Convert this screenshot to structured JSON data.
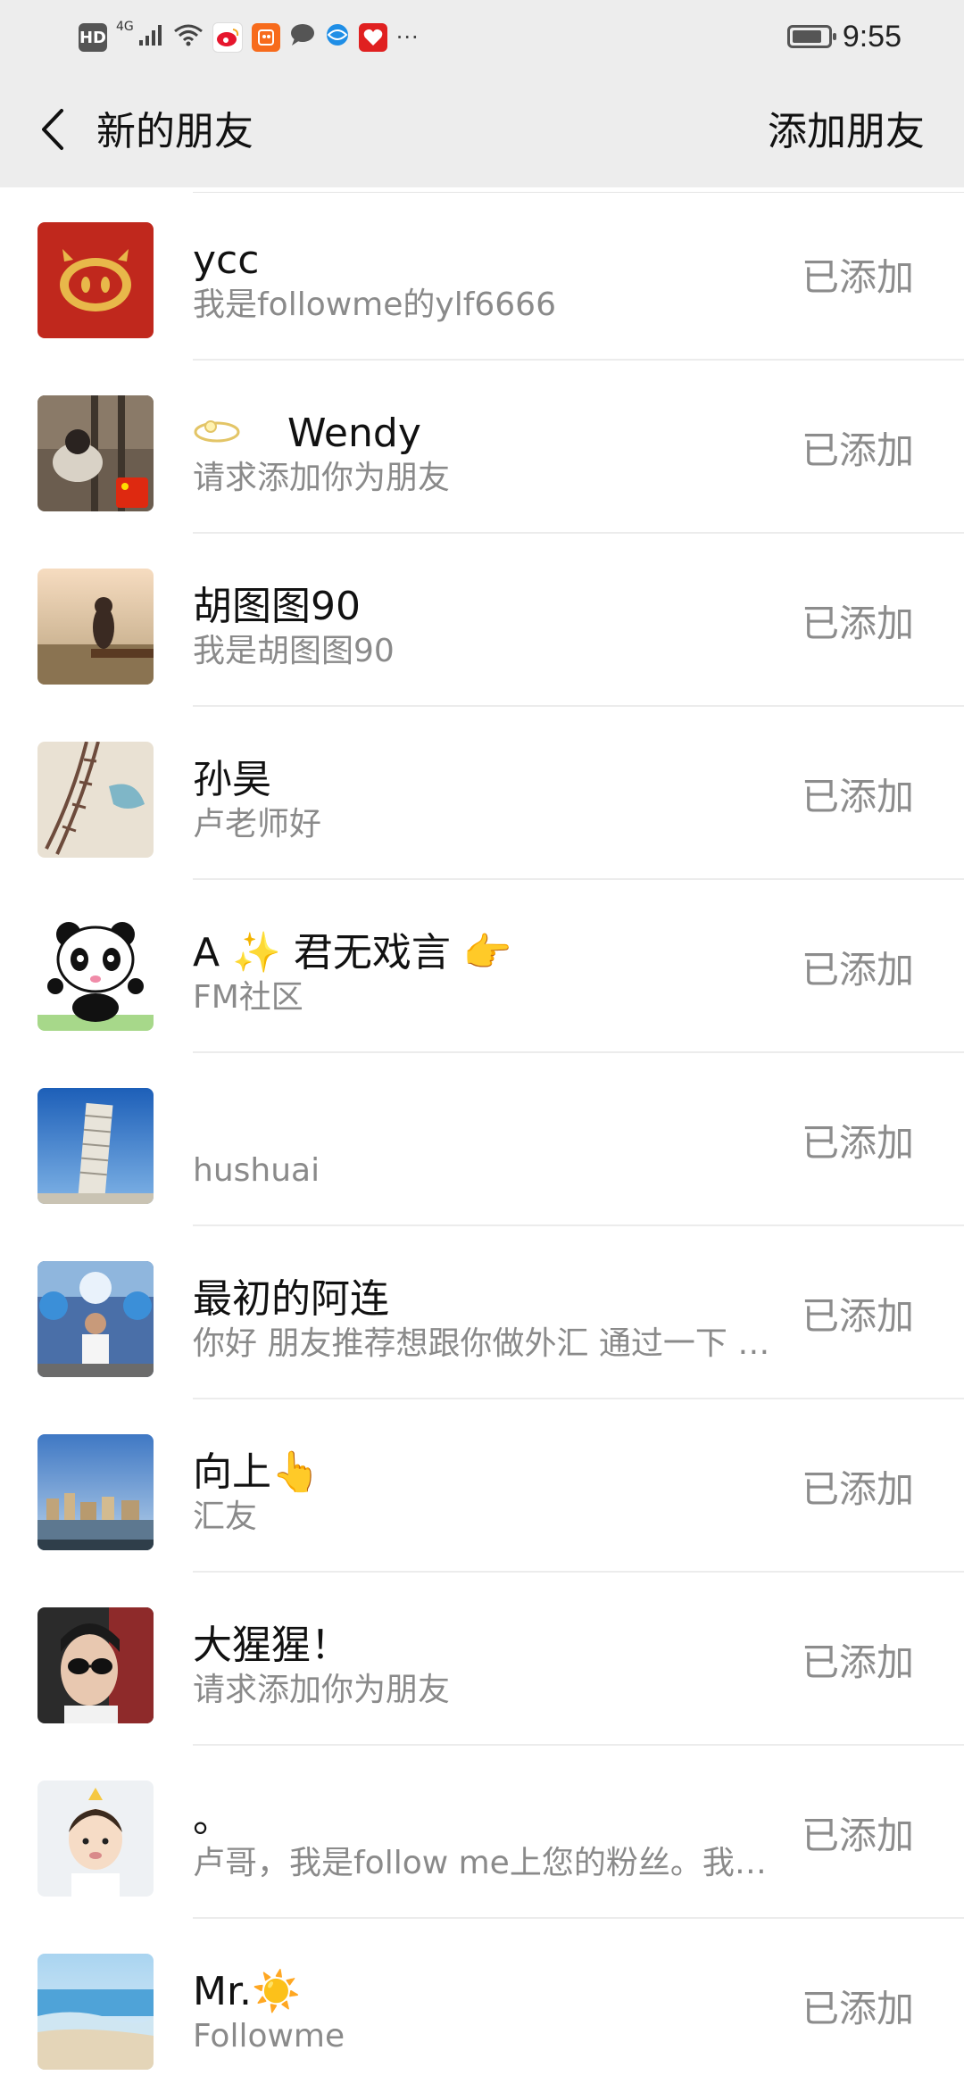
{
  "status_bar": {
    "left_indicators": [
      "HD",
      "4G"
    ],
    "time": "9:55",
    "battery_level": 0.85,
    "icons": [
      "hd-icon",
      "signal-icon",
      "wifi-icon",
      "weibo-icon",
      "kuaikan-icon",
      "chat-icon",
      "browser-icon",
      "heart-app-icon",
      "more-icon"
    ]
  },
  "header": {
    "back_icon": "chevron-left-icon",
    "title": "新的朋友",
    "action_label": "添加朋友"
  },
  "friends": [
    {
      "name": "ycc",
      "message": "我是followme的ylf6666",
      "status": "已添加",
      "avatar": "pig-logo-avatar"
    },
    {
      "name": "Wendy",
      "message": "请求添加你为朋友",
      "status": "已添加",
      "avatar": "photo-avatar",
      "name_prefix_icon": "planet-icon"
    },
    {
      "name": "胡图图90",
      "message": "我是胡图图90",
      "status": "已添加",
      "avatar": "photo-avatar"
    },
    {
      "name": "孙昊",
      "message": "卢老师好",
      "status": "已添加",
      "avatar": "photo-avatar"
    },
    {
      "name": "A ✨ 君无戏言 👉",
      "message": "FM社区",
      "status": "已添加",
      "avatar": "panda-avatar"
    },
    {
      "name": "",
      "message": "hushuai",
      "status": "已添加",
      "avatar": "tower-avatar"
    },
    {
      "name": "最初的阿连",
      "message": "你好  朋友推荐想跟你做外汇  通过一下 谢谢",
      "status": "已添加",
      "avatar": "photo-avatar"
    },
    {
      "name": "向上👆",
      "message": "汇友",
      "status": "已添加",
      "avatar": "city-avatar"
    },
    {
      "name": "大猩猩！",
      "message": "请求添加你为朋友",
      "status": "已添加",
      "avatar": "photo-avatar"
    },
    {
      "name": "。",
      "message": "卢哥，我是follow me上您的粉丝。我想请教一下",
      "status": "已添加",
      "avatar": "baby-avatar"
    },
    {
      "name": "Mr.☀️",
      "message": "Followme",
      "status": "已添加",
      "avatar": "beach-avatar"
    }
  ],
  "colors": {
    "header_bg": "#ededed",
    "name_text": "#111111",
    "message_text": "#8a8a8a",
    "status_text": "#8c8c8c"
  }
}
